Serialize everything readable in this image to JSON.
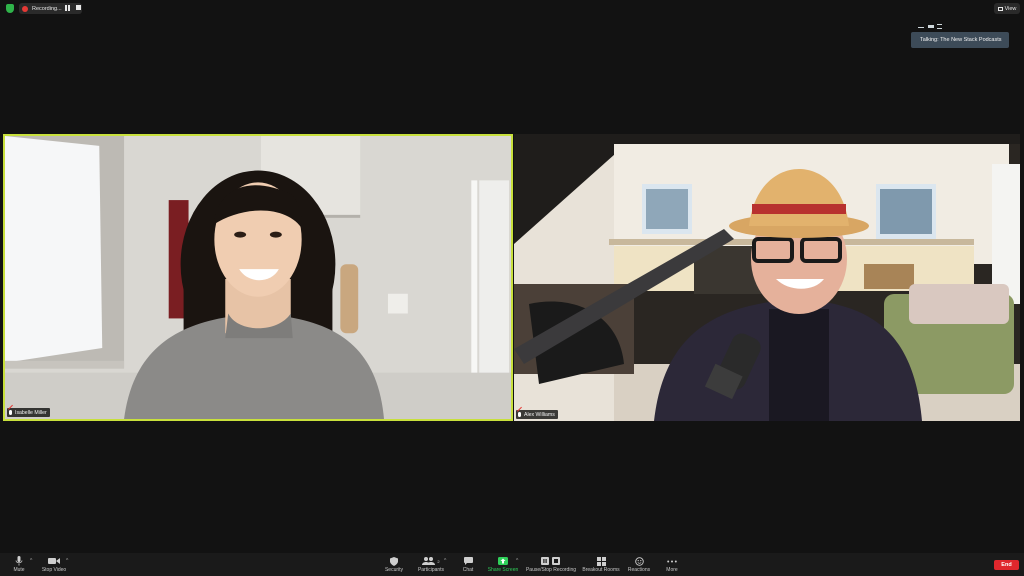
{
  "topbar": {
    "recording_label": "Recording...",
    "view_label": "View"
  },
  "speaker": {
    "talking_label": "Talking: The New Stack Podcasts"
  },
  "participants": [
    {
      "name": "Isabelle Miller",
      "active_speaker": true
    },
    {
      "name": "Alex Williams",
      "active_speaker": false
    }
  ],
  "toolbar": {
    "mute": "Mute",
    "stop_video": "Stop Video",
    "security": "Security",
    "participants": "Participants",
    "participants_count": "2",
    "chat": "Chat",
    "share_screen": "Share Screen",
    "pause_stop_recording": "Pause/Stop Recording",
    "breakout_rooms": "Breakout Rooms",
    "reactions": "Reactions",
    "more": "More",
    "end": "End"
  },
  "colors": {
    "background": "#121212",
    "active_speaker_border": "#c8e03c",
    "share_screen_green": "#2fd05a",
    "end_red": "#e0272d",
    "recording_red": "#e53935",
    "talking_banner": "#3d4b58"
  }
}
